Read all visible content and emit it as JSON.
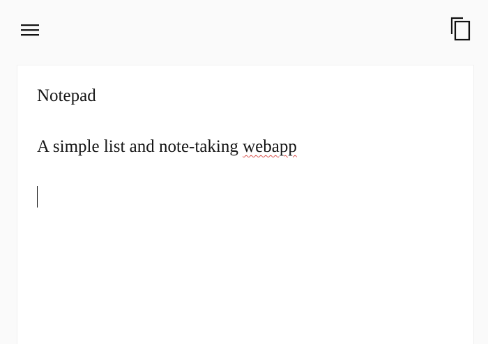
{
  "app": {
    "menu_icon": "hamburger-menu-icon",
    "copy_icon": "copy-icon"
  },
  "note": {
    "lines": [
      "Notepad",
      "A simple list and note-taking"
    ],
    "misspelled_word": "webapp",
    "spellcheck_underline_color": "#d9534f"
  }
}
